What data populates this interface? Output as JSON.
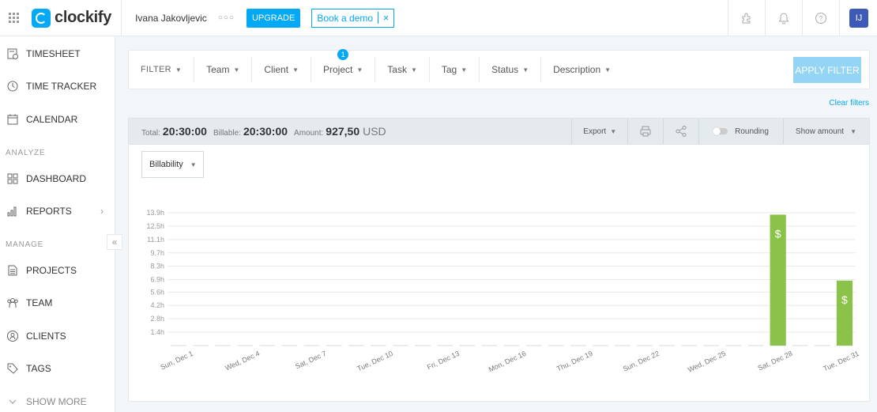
{
  "app": {
    "logo_text": "clockify",
    "workspace": "Ivana Jakovljevic",
    "dots": "○○○",
    "upgrade": "UPGRADE",
    "book_demo": "Book a demo",
    "close": "×",
    "avatar": "IJ",
    "brand_color": "#03a9f4"
  },
  "sidebar": {
    "items": [
      {
        "label": "TIMESHEET",
        "icon": "timesheet-icon"
      },
      {
        "label": "TIME TRACKER",
        "icon": "clock-icon"
      },
      {
        "label": "CALENDAR",
        "icon": "calendar-icon"
      },
      {
        "label": "DASHBOARD",
        "icon": "dashboard-icon"
      },
      {
        "label": "REPORTS",
        "icon": "reports-icon"
      },
      {
        "label": "PROJECTS",
        "icon": "projects-icon"
      },
      {
        "label": "TEAM",
        "icon": "team-icon"
      },
      {
        "label": "CLIENTS",
        "icon": "clients-icon"
      },
      {
        "label": "TAGS",
        "icon": "tag-icon"
      },
      {
        "label": "SHOW MORE",
        "icon": "chevron-down-icon"
      }
    ],
    "section_analyze": "ANALYZE",
    "section_manage": "MANAGE",
    "collapse": "«"
  },
  "filters": {
    "items": [
      "FILTER",
      "Team",
      "Client",
      "Project",
      "Task",
      "Tag",
      "Status",
      "Description"
    ],
    "project_badge": "1",
    "apply": "APPLY FILTER",
    "clear": "Clear filters"
  },
  "summary": {
    "total_label": "Total:",
    "total": "20:30:00",
    "billable_label": "Billable:",
    "billable": "20:30:00",
    "amount_label": "Amount:",
    "amount": "927,50",
    "currency": "USD",
    "export": "Export",
    "rounding": "Rounding",
    "show_amount": "Show amount"
  },
  "billability": {
    "selected": "Billability"
  },
  "chart_data": {
    "type": "bar",
    "x_tick_labels": [
      "Sun, Dec 1",
      "Wed, Dec 4",
      "Sat, Dec 7",
      "Tue, Dec 10",
      "Fri, Dec 13",
      "Mon, Dec 16",
      "Thu, Dec 19",
      "Sun, Dec 22",
      "Wed, Dec 25",
      "Sat, Dec 28",
      "Tue, Dec 31"
    ],
    "y_tick_labels": [
      "1.4h",
      "2.8h",
      "4.2h",
      "5.6h",
      "6.9h",
      "8.3h",
      "9.7h",
      "11.1h",
      "12.5h",
      "13.9h"
    ],
    "y_ticks": [
      1.4,
      2.8,
      4.2,
      5.6,
      6.9,
      8.3,
      9.7,
      11.1,
      12.5,
      13.9
    ],
    "ylim": [
      0,
      13.9
    ],
    "days": 31,
    "bars": [
      {
        "day": 28,
        "hours": 13.7,
        "label": "$"
      },
      {
        "day": 31,
        "hours": 6.8,
        "label": "$"
      }
    ],
    "bar_color": "#8bc34a",
    "grid": true
  }
}
